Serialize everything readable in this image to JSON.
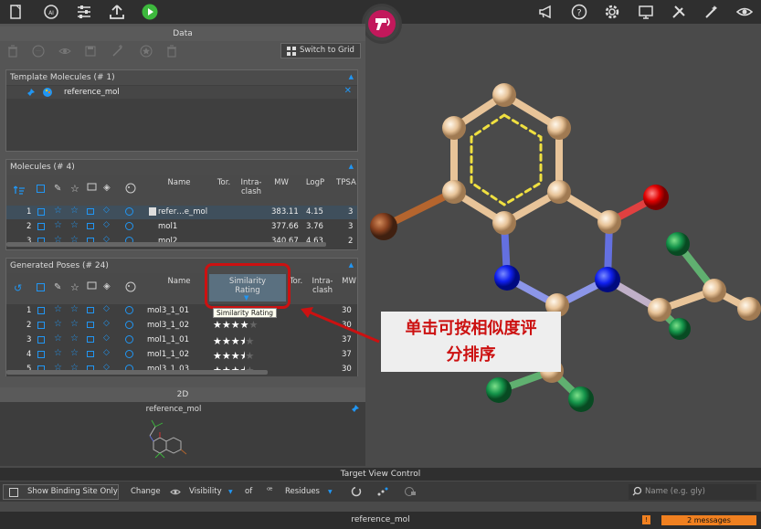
{
  "app": {
    "toolbar_icons": [
      "file-icon",
      "ai-icon",
      "sliders-icon",
      "upload-icon",
      "play-icon"
    ],
    "right_icons": [
      "megaphone-icon",
      "help-icon",
      "settings-icon",
      "monitor-icon",
      "tools-icon",
      "magic-wand-icon",
      "eye-icon"
    ]
  },
  "data_panel": {
    "title": "Data",
    "switch_button": "Switch to Grid",
    "template": {
      "title": "Template Molecules (# 1)",
      "item": "reference_mol"
    },
    "molecules": {
      "title": "Molecules (# 4)",
      "columns": {
        "name": "Name",
        "tor": "Tor.",
        "intra": "Intra-\nclash",
        "mw": "MW",
        "logp": "LogP",
        "tpsa": "TPSA"
      },
      "rows": [
        {
          "idx": "1",
          "name": "refer…e_mol",
          "mw": "383.11",
          "logp": "4.15",
          "tpsa": "3"
        },
        {
          "idx": "2",
          "name": "mol1",
          "mw": "377.66",
          "logp": "3.76",
          "tpsa": "3"
        },
        {
          "idx": "3",
          "name": "mol2",
          "mw": "340.67",
          "logp": "4.63",
          "tpsa": "2"
        }
      ]
    },
    "poses": {
      "title": "Generated Poses (# 24)",
      "columns": {
        "name": "Name",
        "similarity": "Similarity\nRating",
        "tor": "Tor.",
        "intra": "Intra-\nclash",
        "mw": "MW"
      },
      "tooltip": "Similarity Rating",
      "rows": [
        {
          "idx": "1",
          "name": "mol3_1_01",
          "mw": "30",
          "stars": 4
        },
        {
          "idx": "2",
          "name": "mol3_1_02",
          "mw": "30",
          "stars": 4
        },
        {
          "idx": "3",
          "name": "mol1_1_01",
          "mw": "37",
          "stars": 3.5
        },
        {
          "idx": "4",
          "name": "mol1_1_02",
          "mw": "37",
          "stars": 3.5
        },
        {
          "idx": "5",
          "name": "mol3_1_03",
          "mw": "30",
          "stars": 3.5
        }
      ]
    },
    "panel2d": {
      "title": "2D",
      "name": "reference_mol"
    }
  },
  "callout": {
    "line1": "单击可按相似度评",
    "line2": "分排序"
  },
  "target_view": {
    "title": "Target View Control",
    "show_binding": "Show Binding Site Only",
    "change": "Change",
    "visibility": "Visibility",
    "of": "of",
    "residues": "Residues",
    "search_placeholder": "Name (e.g. gly)"
  },
  "status": {
    "center": "reference_mol",
    "messages": "2 messages"
  },
  "colors": {
    "accent": "#c2185b",
    "play": "#3db83d",
    "blue": "#2196f3",
    "alert": "#cc1111",
    "orange": "#f08020"
  }
}
